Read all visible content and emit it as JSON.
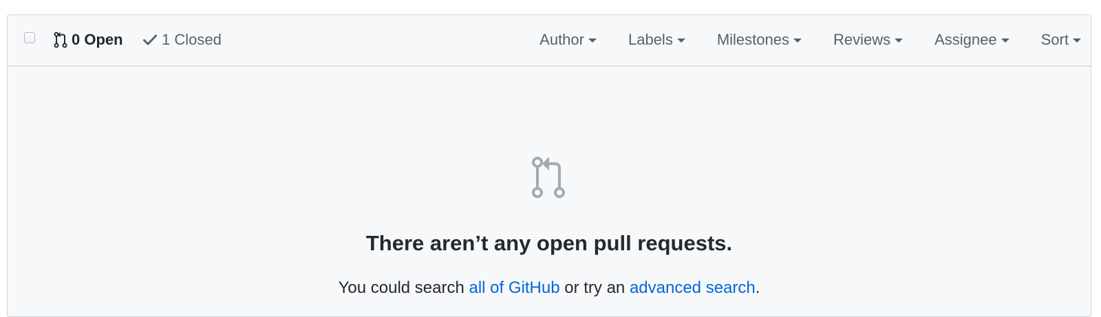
{
  "toolbar": {
    "open_label": "0 Open",
    "closed_label": "1 Closed",
    "filters": {
      "author": "Author",
      "labels": "Labels",
      "milestones": "Milestones",
      "reviews": "Reviews",
      "assignee": "Assignee",
      "sort": "Sort"
    }
  },
  "blankslate": {
    "icon": "git-pull-request-icon",
    "title": "There aren’t any open pull requests.",
    "text_prefix": "You could search ",
    "link_github": "all of GitHub",
    "text_middle": " or try an ",
    "link_advanced": "advanced search",
    "text_suffix": "."
  },
  "colors": {
    "link": "#0366d6",
    "muted_text": "#586069",
    "panel_background": "#f6f8fa",
    "icon_gray": "#a3aab1"
  }
}
